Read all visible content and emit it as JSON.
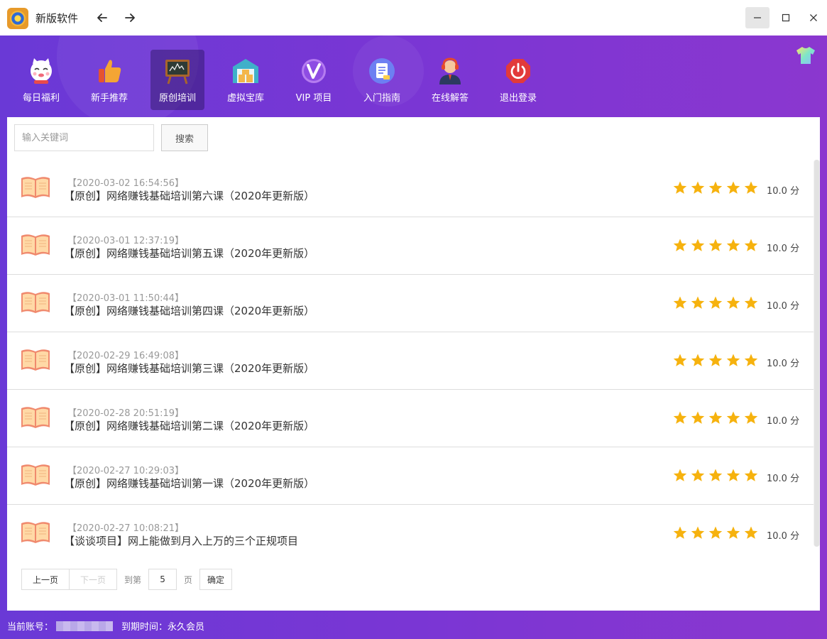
{
  "window": {
    "title": "新版软件"
  },
  "nav": [
    {
      "label": "每日福利",
      "icon": "lucky-cat-icon"
    },
    {
      "label": "新手推荐",
      "icon": "thumbs-up-icon"
    },
    {
      "label": "原创培训",
      "icon": "blackboard-icon",
      "active": true
    },
    {
      "label": "虚拟宝库",
      "icon": "warehouse-icon"
    },
    {
      "label": "VIP 项目",
      "icon": "vip-icon"
    },
    {
      "label": "入门指南",
      "icon": "guide-document-icon"
    },
    {
      "label": "在线解答",
      "icon": "support-agent-icon"
    },
    {
      "label": "退出登录",
      "icon": "power-icon"
    }
  ],
  "search": {
    "placeholder": "输入关键词",
    "button_label": "搜索"
  },
  "articles": [
    {
      "date": "【2020-03-02 16:54:56】",
      "title": "【原创】网络赚钱基础培训第六课（2020年更新版）",
      "rating": 5,
      "score": "10.0 分"
    },
    {
      "date": "【2020-03-01 12:37:19】",
      "title": "【原创】网络赚钱基础培训第五课（2020年更新版）",
      "rating": 5,
      "score": "10.0 分"
    },
    {
      "date": "【2020-03-01 11:50:44】",
      "title": "【原创】网络赚钱基础培训第四课（2020年更新版）",
      "rating": 5,
      "score": "10.0 分"
    },
    {
      "date": "【2020-02-29 16:49:08】",
      "title": "【原创】网络赚钱基础培训第三课（2020年更新版）",
      "rating": 5,
      "score": "10.0 分"
    },
    {
      "date": "【2020-02-28 20:51:19】",
      "title": "【原创】网络赚钱基础培训第二课（2020年更新版）",
      "rating": 5,
      "score": "10.0 分"
    },
    {
      "date": "【2020-02-27 10:29:03】",
      "title": "【原创】网络赚钱基础培训第一课（2020年更新版）",
      "rating": 5,
      "score": "10.0 分"
    },
    {
      "date": "【2020-02-27 10:08:21】",
      "title": "【谈谈项目】网上能做到月入上万的三个正规项目",
      "rating": 5,
      "score": "10.0 分"
    }
  ],
  "pagination": {
    "prev_label": "上一页",
    "next_label": "下一页",
    "goto_label": "到第",
    "page_value": "5",
    "page_suffix": "页",
    "confirm_label": "确定"
  },
  "footer": {
    "account_label": "当前账号：",
    "expiry_label": "到期时间：",
    "expiry_value": "永久会员"
  },
  "colors": {
    "header_start": "#6a39d6",
    "header_end": "#8b37cf",
    "star": "#f6b20e"
  }
}
